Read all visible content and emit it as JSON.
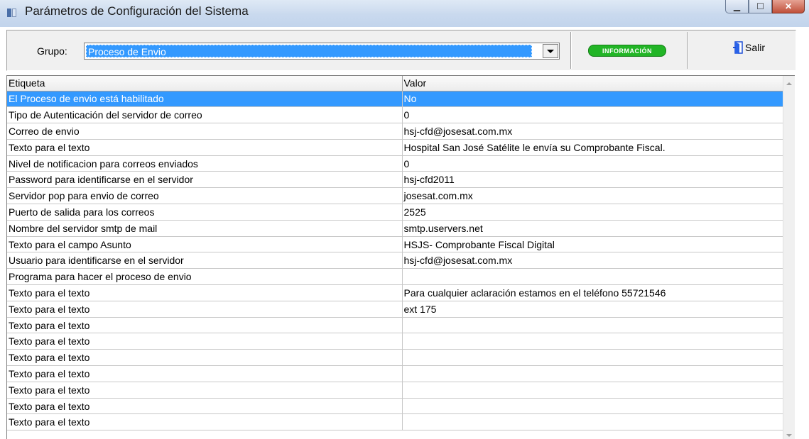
{
  "window": {
    "title": "Parámetros de Configuración del Sistema"
  },
  "toolbar": {
    "grupo_label": "Grupo:",
    "grupo_value": "Proceso de Envio",
    "info_label": "INFORMACIÓN",
    "salir_label": "Salir"
  },
  "grid": {
    "columns": [
      "Etiqueta",
      "Valor"
    ],
    "rows": [
      {
        "etiqueta": "El Proceso de envio está habilitado",
        "valor": "No"
      },
      {
        "etiqueta": "Tipo de Autenticación del servidor de correo",
        "valor": "0"
      },
      {
        "etiqueta": "Correo de envio",
        "valor": "hsj-cfd@josesat.com.mx"
      },
      {
        "etiqueta": "Texto para el texto",
        "valor": "Hospital San José Satélite le envía su Comprobante Fiscal."
      },
      {
        "etiqueta": "Nivel de notificacion para correos enviados",
        "valor": "0"
      },
      {
        "etiqueta": "Password para identificarse en el servidor",
        "valor": "hsj-cfd2011"
      },
      {
        "etiqueta": "Servidor pop para envio de correo",
        "valor": "josesat.com.mx"
      },
      {
        "etiqueta": "Puerto de salida para los correos",
        "valor": "2525"
      },
      {
        "etiqueta": "Nombre del servidor smtp de mail",
        "valor": "smtp.uservers.net"
      },
      {
        "etiqueta": "Texto para el campo Asunto",
        "valor": "HSJS- Comprobante Fiscal Digital"
      },
      {
        "etiqueta": "Usuario para identificarse en el servidor",
        "valor": "hsj-cfd@josesat.com.mx"
      },
      {
        "etiqueta": "Programa para hacer el proceso de envio",
        "valor": ""
      },
      {
        "etiqueta": "Texto para el texto",
        "valor": "Para cualquier aclaración estamos en el teléfono 55721546"
      },
      {
        "etiqueta": "Texto para el texto",
        "valor": "ext 175"
      },
      {
        "etiqueta": "Texto para el texto",
        "valor": ""
      },
      {
        "etiqueta": "Texto para el texto",
        "valor": ""
      },
      {
        "etiqueta": "Texto para el texto",
        "valor": ""
      },
      {
        "etiqueta": "Texto para el texto",
        "valor": ""
      },
      {
        "etiqueta": "Texto para el texto",
        "valor": ""
      },
      {
        "etiqueta": "Texto para el texto",
        "valor": ""
      },
      {
        "etiqueta": "Texto para el texto",
        "valor": ""
      }
    ],
    "selected_row": 0
  },
  "colors": {
    "selection": "#3399ff",
    "info_button": "#22b526"
  }
}
